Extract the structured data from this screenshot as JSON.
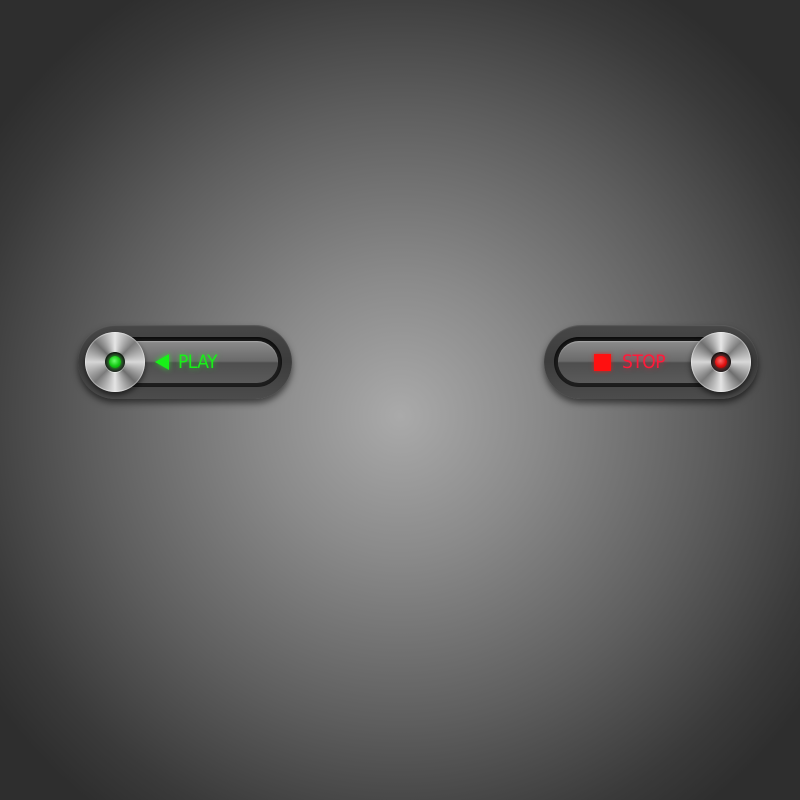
{
  "controls": {
    "play": {
      "label": "PLAY",
      "symbol": "play-triangle",
      "led_color": "#18f018",
      "text_color": "#18f018",
      "state": "on"
    },
    "stop": {
      "label": "STOP",
      "symbol": "stop-square",
      "led_color": "#ff1010",
      "text_color": "#ff1a3a",
      "state": "off"
    }
  },
  "theme": {
    "background_center": "#aaaaaa",
    "background_edge": "#2e2e2e"
  }
}
